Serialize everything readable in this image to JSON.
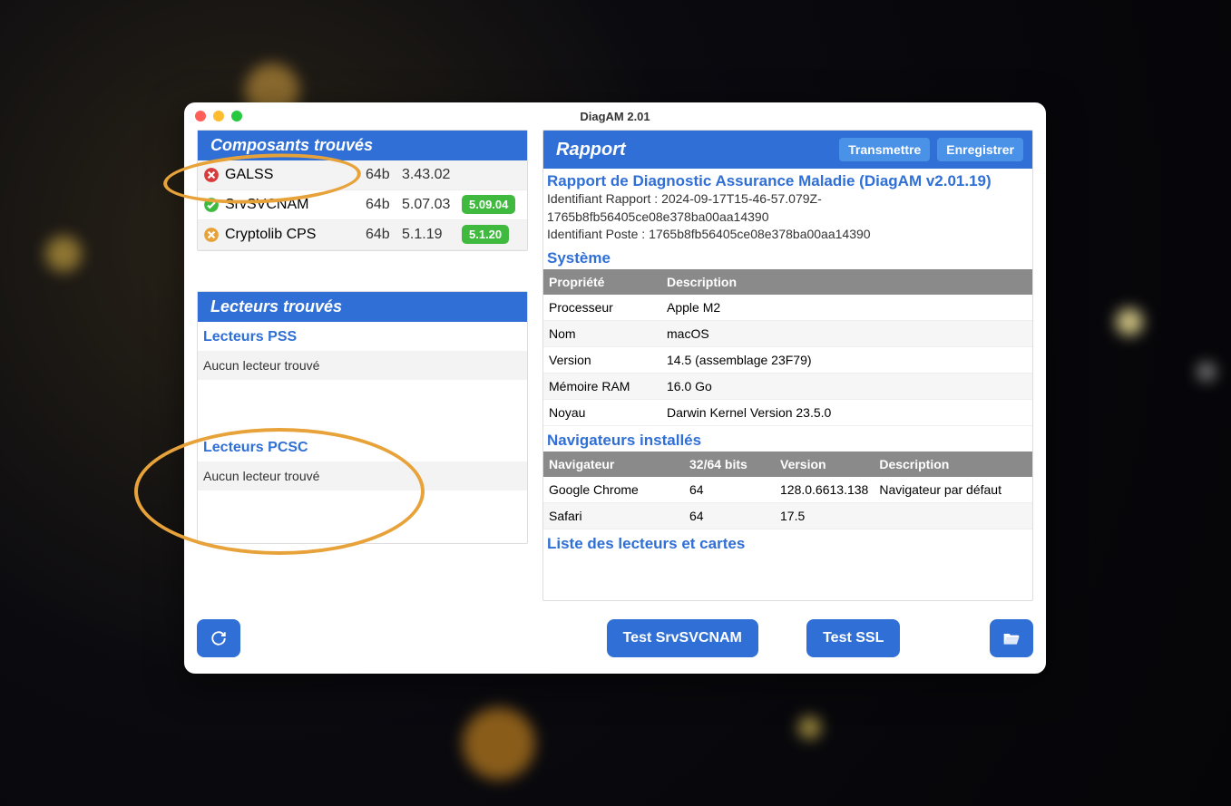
{
  "window": {
    "title": "DiagAM 2.01"
  },
  "left": {
    "components_header": "Composants trouvés",
    "components": [
      {
        "status": "error",
        "name": "GALSS",
        "bits": "64b",
        "version": "3.43.02",
        "update": ""
      },
      {
        "status": "ok",
        "name": "SrvSVCNAM",
        "bits": "64b",
        "version": "5.07.03",
        "update": "5.09.04"
      },
      {
        "status": "warn",
        "name": "Cryptolib CPS",
        "bits": "64b",
        "version": "5.1.19",
        "update": "5.1.20"
      }
    ],
    "readers_header": "Lecteurs trouvés",
    "readers_pss": {
      "title": "Lecteurs PSS",
      "msg": "Aucun lecteur trouvé"
    },
    "readers_pcsc": {
      "title": "Lecteurs PCSC",
      "msg": "Aucun lecteur trouvé"
    }
  },
  "report": {
    "header": "Rapport",
    "transmit": "Transmettre",
    "save": "Enregistrer",
    "title": "Rapport de Diagnostic Assurance Maladie (DiagAM v2.01.19)",
    "ident_report_label": "Identifiant Rapport : ",
    "ident_report": "2024-09-17T15-46-57.079Z-1765b8fb56405ce08e378ba00aa14390",
    "ident_poste_label": "Identifiant Poste : ",
    "ident_poste": "1765b8fb56405ce08e378ba00aa14390",
    "system_header": "Système",
    "system_columns": {
      "prop": "Propriété",
      "desc": "Description"
    },
    "system_rows": [
      {
        "prop": "Processeur",
        "desc": "Apple M2"
      },
      {
        "prop": "Nom",
        "desc": "macOS"
      },
      {
        "prop": "Version",
        "desc": "14.5 (assemblage 23F79)"
      },
      {
        "prop": "Mémoire RAM",
        "desc": "16.0 Go"
      },
      {
        "prop": "Noyau",
        "desc": "Darwin Kernel Version 23.5.0"
      }
    ],
    "browsers_header": "Navigateurs installés",
    "browsers_columns": {
      "name": "Navigateur",
      "bits": "32/64 bits",
      "version": "Version",
      "desc": "Description"
    },
    "browsers_rows": [
      {
        "name": "Google Chrome",
        "bits": "64",
        "version": "128.0.6613.138",
        "desc": "Navigateur par défaut"
      },
      {
        "name": "Safari",
        "bits": "64",
        "version": "17.5",
        "desc": ""
      }
    ],
    "readers_cards_header": "Liste des lecteurs et cartes"
  },
  "buttons": {
    "test_srv": "Test SrvSVCNAM",
    "test_ssl": "Test SSL"
  }
}
